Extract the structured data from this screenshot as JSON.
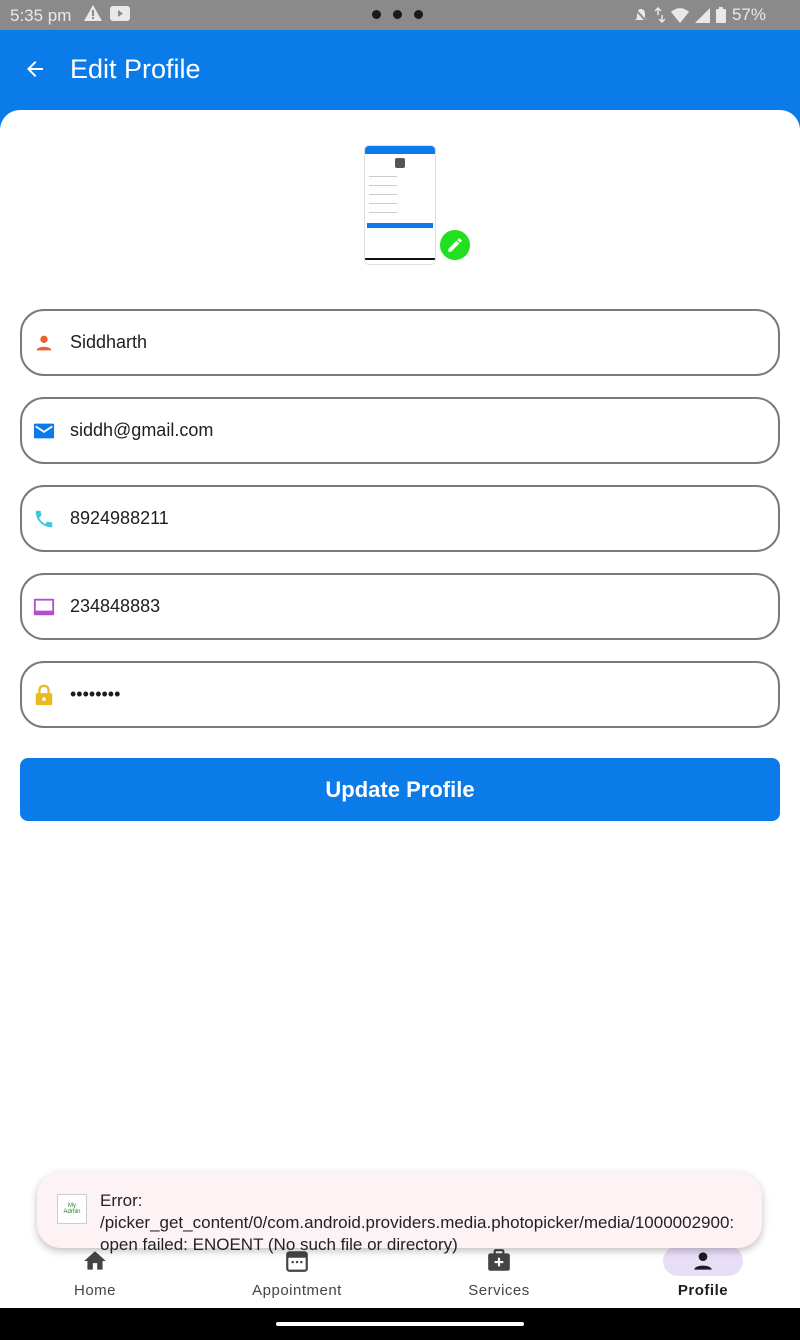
{
  "status_bar": {
    "time": "5:35 pm",
    "battery": "57%"
  },
  "app_bar": {
    "title": "Edit Profile",
    "back_icon": "arrow-back-icon"
  },
  "profile_image": {
    "edit_icon": "pencil-icon",
    "badge_color": "#20e020"
  },
  "form": {
    "name": {
      "value": "Siddharth",
      "icon": "person-icon",
      "icon_color": "#e9612f"
    },
    "email": {
      "value": "siddh@gmail.com",
      "icon": "mail-icon",
      "icon_color": "#0a7be8"
    },
    "phone": {
      "value": "8924988211",
      "icon": "phone-icon",
      "icon_color": "#3cc9d6"
    },
    "id_number": {
      "value": "234848883",
      "icon": "card-icon",
      "icon_color": "#b04fd1"
    },
    "password": {
      "value": "••••••••",
      "icon": "lock-icon",
      "icon_color": "#e8b923"
    }
  },
  "update_button": {
    "label": "Update Profile"
  },
  "toast": {
    "message": "Error: /picker_get_content/0/com.android.providers.media.photopicker/media/1000002900: open failed: ENOENT (No such file or directory)"
  },
  "bottom_nav": {
    "items": [
      {
        "label": "Home",
        "icon": "home-icon"
      },
      {
        "label": "Appointment",
        "icon": "calendar-icon"
      },
      {
        "label": "Services",
        "icon": "medical-plus-icon"
      },
      {
        "label": "Profile",
        "icon": "person-icon",
        "active": true
      }
    ]
  },
  "colors": {
    "primary": "#0a7be8",
    "nav_active_bg": "#e8def8"
  }
}
